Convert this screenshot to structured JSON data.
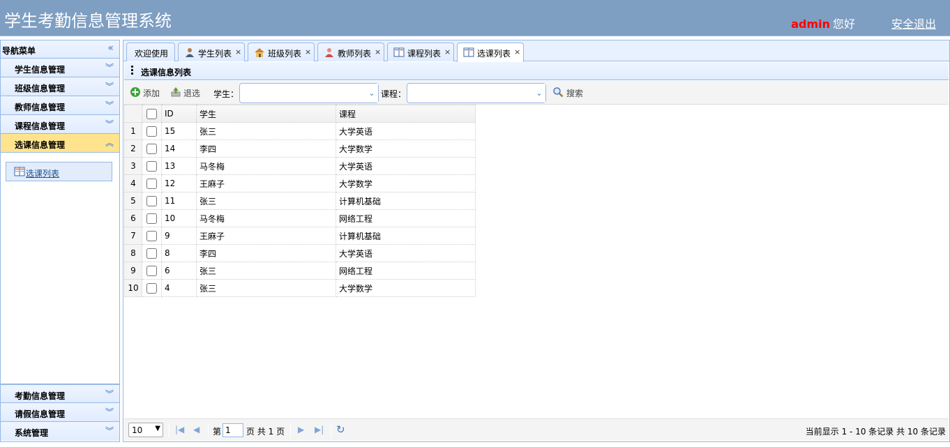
{
  "header": {
    "title": "学生考勤信息管理系统",
    "user_name": "admin",
    "greeting": "您好",
    "logout_label": "安全退出"
  },
  "nav": {
    "title": "导航菜单",
    "sections_top": [
      {
        "label": "学生信息管理"
      },
      {
        "label": "班级信息管理"
      },
      {
        "label": "教师信息管理"
      },
      {
        "label": "课程信息管理"
      },
      {
        "label": "选课信息管理"
      }
    ],
    "active_item": "选课列表",
    "sections_bottom": [
      {
        "label": "考勤信息管理"
      },
      {
        "label": "请假信息管理"
      },
      {
        "label": "系统管理"
      }
    ]
  },
  "tabs": [
    {
      "label": "欢迎使用",
      "closable": false
    },
    {
      "label": "学生列表",
      "closable": true,
      "icon": "user-icon"
    },
    {
      "label": "班级列表",
      "closable": true,
      "icon": "home-icon"
    },
    {
      "label": "教师列表",
      "closable": true,
      "icon": "teacher-icon"
    },
    {
      "label": "课程列表",
      "closable": true,
      "icon": "book-icon"
    },
    {
      "label": "选课列表",
      "closable": true,
      "icon": "book-icon"
    }
  ],
  "panel": {
    "title": "选课信息列表"
  },
  "toolbar": {
    "add_label": "添加",
    "drop_label": "退选",
    "student_label": "学生：",
    "course_label": "课程：",
    "search_label": "搜索"
  },
  "grid": {
    "columns": [
      "ID",
      "学生",
      "课程"
    ],
    "rows": [
      {
        "n": "1",
        "id": "15",
        "student": "张三",
        "course": "大学英语"
      },
      {
        "n": "2",
        "id": "14",
        "student": "李四",
        "course": "大学数学"
      },
      {
        "n": "3",
        "id": "13",
        "student": "马冬梅",
        "course": "大学英语"
      },
      {
        "n": "4",
        "id": "12",
        "student": "王麻子",
        "course": "大学数学"
      },
      {
        "n": "5",
        "id": "11",
        "student": "张三",
        "course": "计算机基础"
      },
      {
        "n": "6",
        "id": "10",
        "student": "马冬梅",
        "course": "网络工程"
      },
      {
        "n": "7",
        "id": "9",
        "student": "王麻子",
        "course": "计算机基础"
      },
      {
        "n": "8",
        "id": "8",
        "student": "李四",
        "course": "大学英语"
      },
      {
        "n": "9",
        "id": "6",
        "student": "张三",
        "course": "网络工程"
      },
      {
        "n": "10",
        "id": "4",
        "student": "张三",
        "course": "大学数学"
      }
    ]
  },
  "pager": {
    "page_size": "10",
    "page_prefix": "第",
    "page_number": "1",
    "page_suffix": "页 共 1 页",
    "info": "当前显示 1 - 10 条记录 共 10 条记录"
  },
  "colors": {
    "header_bg": "#7e9ec2",
    "border": "#95b8e7",
    "active_section": "#ffe48d",
    "user_name": "#ff0000"
  }
}
